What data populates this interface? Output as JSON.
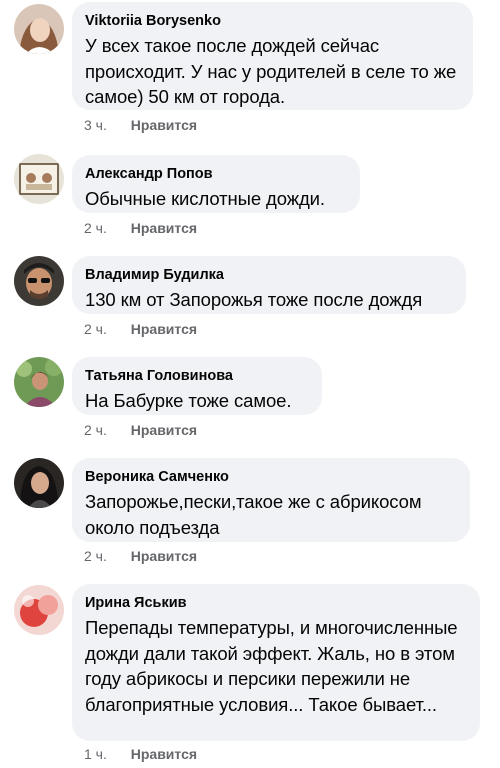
{
  "comments": [
    {
      "author": "Viktoriia Borysenko",
      "text": "У всех такое после дождей сейчас происходит. У нас у родителей в селе то же самое) 50 км от города.",
      "time": "3 ч.",
      "like": "Нравится",
      "avatar_icon": "profile-photo-woman-icon"
    },
    {
      "author": "Александр Попов",
      "text": "Обычные кислотные дожди.",
      "time": "2 ч.",
      "like": "Нравится",
      "avatar_icon": "profile-photo-cartoon-icon"
    },
    {
      "author": "Владимир Будилка",
      "text": "130 км от Запорожья тоже после дождя",
      "time": "2 ч.",
      "like": "Нравится",
      "avatar_icon": "profile-photo-man-icon"
    },
    {
      "author": "Татьяна Головинова",
      "text": "На Бабурке тоже самое.",
      "time": "2 ч.",
      "like": "Нравится",
      "avatar_icon": "profile-photo-woman-garden-icon"
    },
    {
      "author": "Вероника Самченко",
      "text": "Запорожье,пески,такое же с абрикосом около подъезда",
      "time": "2 ч.",
      "like": "Нравится",
      "avatar_icon": "profile-photo-woman-dark-icon"
    },
    {
      "author": "Ирина Яськив",
      "text": "Перепады температуры, и многочисленные дожди дали такой эффект. Жаль, но в этом году абрикосы и персики пережили не благоприятные условия... Такое бывает...",
      "time": "1 ч.",
      "like": "Нравится",
      "avatar_icon": "profile-photo-red-icon"
    }
  ],
  "colors": {
    "bubble": "#f0f2f5",
    "meta_text": "#65676b",
    "body_text": "#050505"
  }
}
